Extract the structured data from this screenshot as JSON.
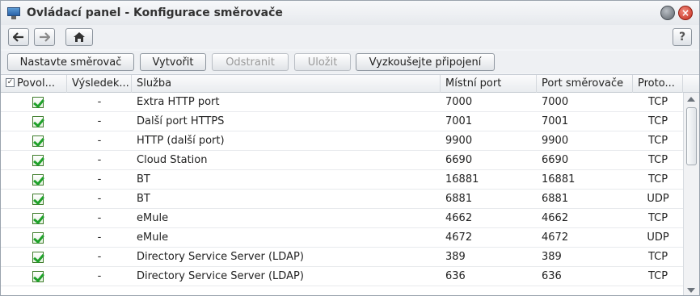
{
  "window": {
    "title": "Ovládací panel - Konfigurace směrovače",
    "icon": "control-panel-icon"
  },
  "nav": {
    "back": "back-arrow-icon",
    "forward": "forward-arrow-icon",
    "home": "home-icon",
    "help_label": "?"
  },
  "toolbar": {
    "setup_router_label": "Nastavte směrovač",
    "create_label": "Vytvořit",
    "delete_label": "Odstranit",
    "save_label": "Uložit",
    "test_connection_label": "Vyzkoušejte připojení"
  },
  "table": {
    "columns": {
      "enabled": "Povol...",
      "result": "Výsledek...",
      "service": "Služba",
      "local_port": "Místní port",
      "router_port": "Port směrovače",
      "protocol": "Proto..."
    },
    "rows": [
      {
        "enabled": true,
        "result": "-",
        "service": "Extra HTTP port",
        "local_port": "7000",
        "router_port": "7000",
        "protocol": "TCP"
      },
      {
        "enabled": true,
        "result": "-",
        "service": "Další port HTTPS",
        "local_port": "7001",
        "router_port": "7001",
        "protocol": "TCP"
      },
      {
        "enabled": true,
        "result": "-",
        "service": "HTTP (další port)",
        "local_port": "9900",
        "router_port": "9900",
        "protocol": "TCP"
      },
      {
        "enabled": true,
        "result": "-",
        "service": "Cloud Station",
        "local_port": "6690",
        "router_port": "6690",
        "protocol": "TCP"
      },
      {
        "enabled": true,
        "result": "-",
        "service": "BT",
        "local_port": "16881",
        "router_port": "16881",
        "protocol": "TCP"
      },
      {
        "enabled": true,
        "result": "-",
        "service": "BT",
        "local_port": "6881",
        "router_port": "6881",
        "protocol": "UDP"
      },
      {
        "enabled": true,
        "result": "-",
        "service": "eMule",
        "local_port": "4662",
        "router_port": "4662",
        "protocol": "TCP"
      },
      {
        "enabled": true,
        "result": "-",
        "service": "eMule",
        "local_port": "4672",
        "router_port": "4672",
        "protocol": "UDP"
      },
      {
        "enabled": true,
        "result": "-",
        "service": "Directory Service Server (LDAP)",
        "local_port": "389",
        "router_port": "389",
        "protocol": "TCP"
      },
      {
        "enabled": true,
        "result": "-",
        "service": "Directory Service Server (LDAP)",
        "local_port": "636",
        "router_port": "636",
        "protocol": "TCP"
      }
    ]
  }
}
